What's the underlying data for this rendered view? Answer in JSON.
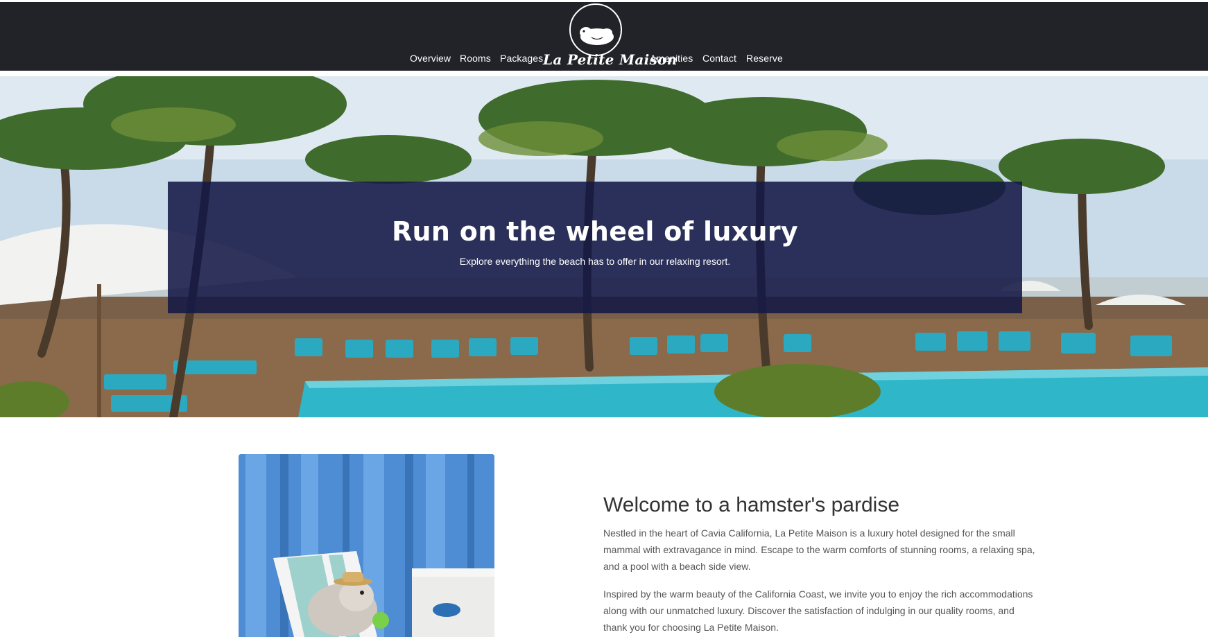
{
  "nav": {
    "left_items": [
      "Overview",
      "Rooms",
      "Packages"
    ],
    "logo_text": "La Petite Maison",
    "right_items": [
      "Amenities",
      "Contact",
      "Reserve"
    ]
  },
  "hero": {
    "title": "Run on the wheel of luxury",
    "subtitle": "Explore everything the beach has to offer in our relaxing resort."
  },
  "welcome": {
    "title": "Welcome to a hamster's pardise",
    "paragraph1": "Nestled in the heart of Cavia California, La Petite Maison is a luxury hotel designed for the small mammal with extravagance in mind. Escape to the warm comforts of stunning rooms, a relaxing spa, and a pool with a beach side view.",
    "paragraph2": "Inspired by the warm beauty of the California Coast, we invite you to enjoy the rich accommodations along with our unmatched luxury. Discover the satisfaction of indulging in our quality rooms, and thank you for choosing La Petite Maison."
  },
  "colors": {
    "nav_bg": "#212328",
    "hero_panel": "#14184a",
    "pool": "#2fb6c9",
    "loungers": "#2aa9c0"
  }
}
